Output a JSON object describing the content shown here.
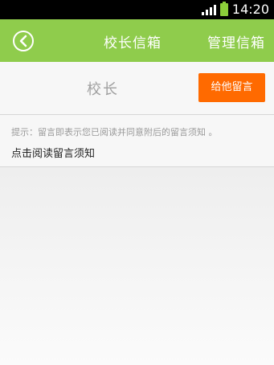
{
  "status_bar": {
    "time": "14:20",
    "battery_level": 1.0,
    "icons": [
      "signal-icon",
      "battery-icon"
    ]
  },
  "nav": {
    "back_icon": "back-circle-icon",
    "title": "校长信箱",
    "right_label": "管理信箱",
    "bg_color": "#8fcc4c"
  },
  "header": {
    "role_label": "校长",
    "message_button": "给他留言",
    "button_color": "#ff6a00"
  },
  "notice": {
    "tip": "提示：留言即表示您已阅读并同意附后的留言须知 。",
    "read_link": "点击阅读留言须知"
  }
}
